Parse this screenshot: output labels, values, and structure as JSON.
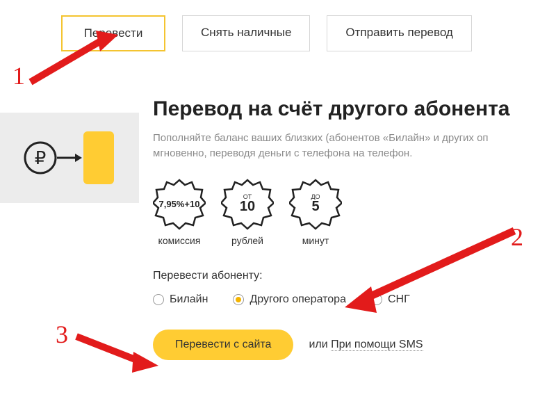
{
  "tabs": {
    "transfer": "Перевести",
    "withdraw": "Снять наличные",
    "send": "Отправить перевод"
  },
  "page": {
    "title": "Перевод на счёт другого абонента",
    "subtitle": "Пополняйте баланс ваших близких (абонентов «Билайн» и других оп мгновенно, переводя деньги с телефона на телефон."
  },
  "badges": {
    "commission": {
      "main": "7,95%+10",
      "caption": "комиссия"
    },
    "min_amount": {
      "top": "ОТ",
      "main": "10",
      "caption": "рублей"
    },
    "time": {
      "top": "ДО",
      "main": "5",
      "caption": "минут"
    }
  },
  "form": {
    "label": "Перевести абоненту:",
    "options": {
      "beeline": "Билайн",
      "other": "Другого оператора",
      "cis": "СНГ"
    },
    "submit": "Перевести с сайта",
    "alt_or": "или",
    "alt_link": "При помощи SMS"
  },
  "annotations": {
    "n1": "1",
    "n2": "2",
    "n3": "3"
  }
}
